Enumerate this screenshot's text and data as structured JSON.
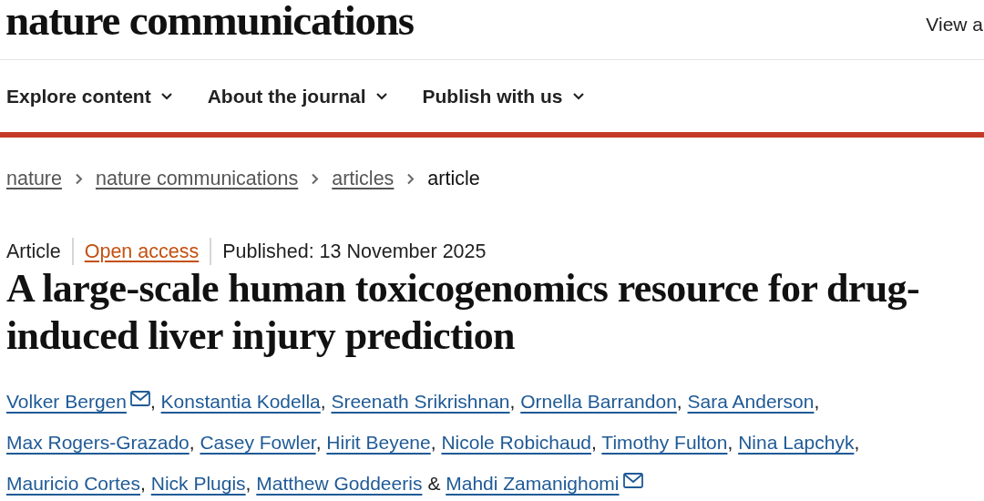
{
  "header": {
    "logo": "nature communications",
    "header_link": "View a"
  },
  "nav": [
    {
      "label": "Explore content"
    },
    {
      "label": "About the journal"
    },
    {
      "label": "Publish with us"
    }
  ],
  "breadcrumbs": [
    {
      "label": "nature",
      "current": false
    },
    {
      "label": "nature communications",
      "current": false
    },
    {
      "label": "articles",
      "current": false
    },
    {
      "label": "article",
      "current": true
    }
  ],
  "article_meta": {
    "type": "Article",
    "access": "Open access",
    "published": "Published: 13 November 2025"
  },
  "title": "A large-scale human toxicogenomics resource for drug-induced liver injury prediction",
  "authors": [
    {
      "name": "Volker Bergen",
      "email": true,
      "sep": ","
    },
    {
      "name": "Konstantia Kodella",
      "email": false,
      "sep": ","
    },
    {
      "name": "Sreenath Srikrishnan",
      "email": false,
      "sep": ","
    },
    {
      "name": "Ornella Barrandon",
      "email": false,
      "sep": ","
    },
    {
      "name": "Sara Anderson",
      "email": false,
      "sep": ","
    },
    {
      "name": "Max Rogers-Grazado",
      "email": false,
      "sep": ","
    },
    {
      "name": "Casey Fowler",
      "email": false,
      "sep": ","
    },
    {
      "name": "Hirit Beyene",
      "email": false,
      "sep": ","
    },
    {
      "name": "Nicole Robichaud",
      "email": false,
      "sep": ","
    },
    {
      "name": "Timothy Fulton",
      "email": false,
      "sep": ","
    },
    {
      "name": "Nina Lapchyk",
      "email": false,
      "sep": ","
    },
    {
      "name": "Mauricio Cortes",
      "email": false,
      "sep": ","
    },
    {
      "name": "Nick Plugis",
      "email": false,
      "sep": ","
    },
    {
      "name": "Matthew Goddeeris",
      "email": false,
      "sep": "&",
      "kind": "joined"
    },
    {
      "name": "Mahdi Zamanighomi",
      "email": true
    }
  ]
}
